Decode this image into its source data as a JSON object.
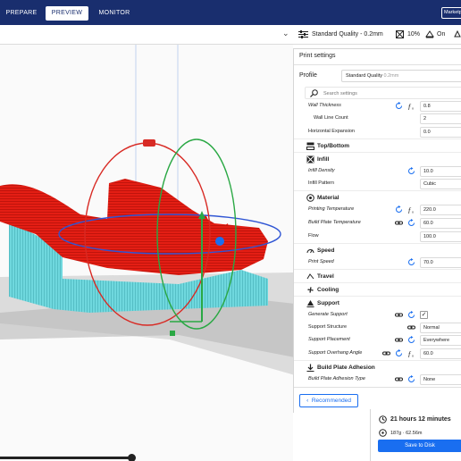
{
  "topbar": {
    "tabs": [
      {
        "label": "PREPARE",
        "active": false
      },
      {
        "label": "PREVIEW",
        "active": true
      },
      {
        "label": "MONITOR",
        "active": false
      }
    ],
    "marketplace_label": "Marketp"
  },
  "quality_bar": {
    "profile": "Standard Quality - 0.2mm",
    "infill": "10%",
    "support": "On"
  },
  "panel": {
    "title": "Print settings",
    "profile_label": "Profile",
    "profile_value": "Standard Quality",
    "profile_sub": "0.2mm",
    "search_placeholder": "Search settings",
    "rows": {
      "wall_thickness": {
        "label": "Wall Thickness",
        "value": "0.8"
      },
      "wall_line_count": {
        "label": "Wall Line Count",
        "value": "2"
      },
      "horizontal_expansion": {
        "label": "Horizontal Expansion",
        "value": "0.0"
      },
      "infill_density": {
        "label": "Infill Density",
        "value": "10.0"
      },
      "infill_pattern": {
        "label": "Infill Pattern",
        "value": "Cubic"
      },
      "printing_temperature": {
        "label": "Printing Temperature",
        "value": "220.0"
      },
      "build_plate_temperature": {
        "label": "Build Plate Temperature",
        "value": "60.0"
      },
      "flow": {
        "label": "Flow",
        "value": "100.0"
      },
      "print_speed": {
        "label": "Print Speed",
        "value": "70.0"
      },
      "generate_support": {
        "label": "Generate Support",
        "value": "✓"
      },
      "support_structure": {
        "label": "Support Structure",
        "value": "Normal"
      },
      "support_placement": {
        "label": "Support Placement",
        "value": "Everywhere"
      },
      "support_overhang_angle": {
        "label": "Support Overhang Angle",
        "value": "60.0"
      },
      "build_plate_adhesion_type": {
        "label": "Build Plate Adhesion Type",
        "value": "None"
      }
    },
    "categories": {
      "top_bottom": "Top/Bottom",
      "infill": "Infill",
      "material": "Material",
      "speed": "Speed",
      "travel": "Travel",
      "cooling": "Cooling",
      "support": "Support",
      "adhesion": "Build Plate Adhesion"
    },
    "recommended_label": "Recommended"
  },
  "output": {
    "time": "21 hours 12 minutes",
    "material": "187g · 62.56m",
    "save_label": "Save to Disk"
  },
  "colors": {
    "header_bg": "#192e6e",
    "accent": "#196ef0",
    "model_red": "#e41e14",
    "support_cyan": "#5fd2d8"
  }
}
